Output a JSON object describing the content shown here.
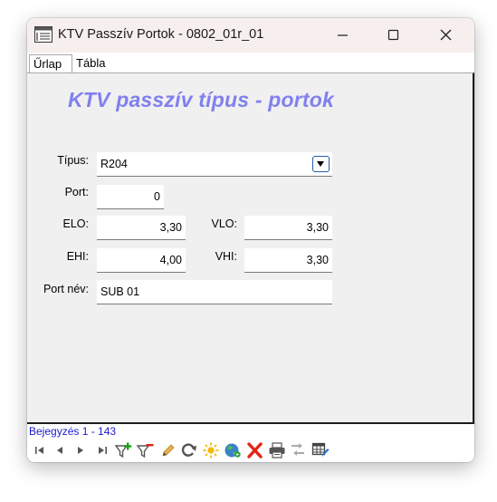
{
  "window": {
    "title": "KTV Passzív Portok - 0802_01r_01"
  },
  "tabs": [
    {
      "label": "Űrlap",
      "active": true
    },
    {
      "label": "Tábla",
      "active": false
    }
  ],
  "form": {
    "heading": "KTV passzív típus - portok",
    "fields": {
      "tipus": {
        "label": "Típus:",
        "value": "R204"
      },
      "port": {
        "label": "Port:",
        "value": "0"
      },
      "elo": {
        "label": "ELO:",
        "value": "3,30"
      },
      "vlo": {
        "label": "VLO:",
        "value": "3,30"
      },
      "ehi": {
        "label": "EHI:",
        "value": "4,00"
      },
      "vhi": {
        "label": "VHI:",
        "value": "3,30"
      },
      "port_nev": {
        "label": "Port név:",
        "value": "SUB 01"
      }
    }
  },
  "status": {
    "record_text": "Bejegyzés 1 - 143"
  },
  "toolbar": {
    "icons": [
      "first-record-icon",
      "previous-record-icon",
      "next-record-icon",
      "last-record-icon",
      "add-filter-icon",
      "remove-filter-icon",
      "edit-pencil-icon",
      "refresh-icon",
      "new-record-icon",
      "web-globe-icon",
      "delete-icon",
      "print-icon",
      "export-icon",
      "table-settings-icon"
    ]
  },
  "colors": {
    "heading": "#8080ee",
    "status_text": "#1a1ad0",
    "form_background": "#f0f0f0",
    "titlebar": "#f6efee"
  }
}
